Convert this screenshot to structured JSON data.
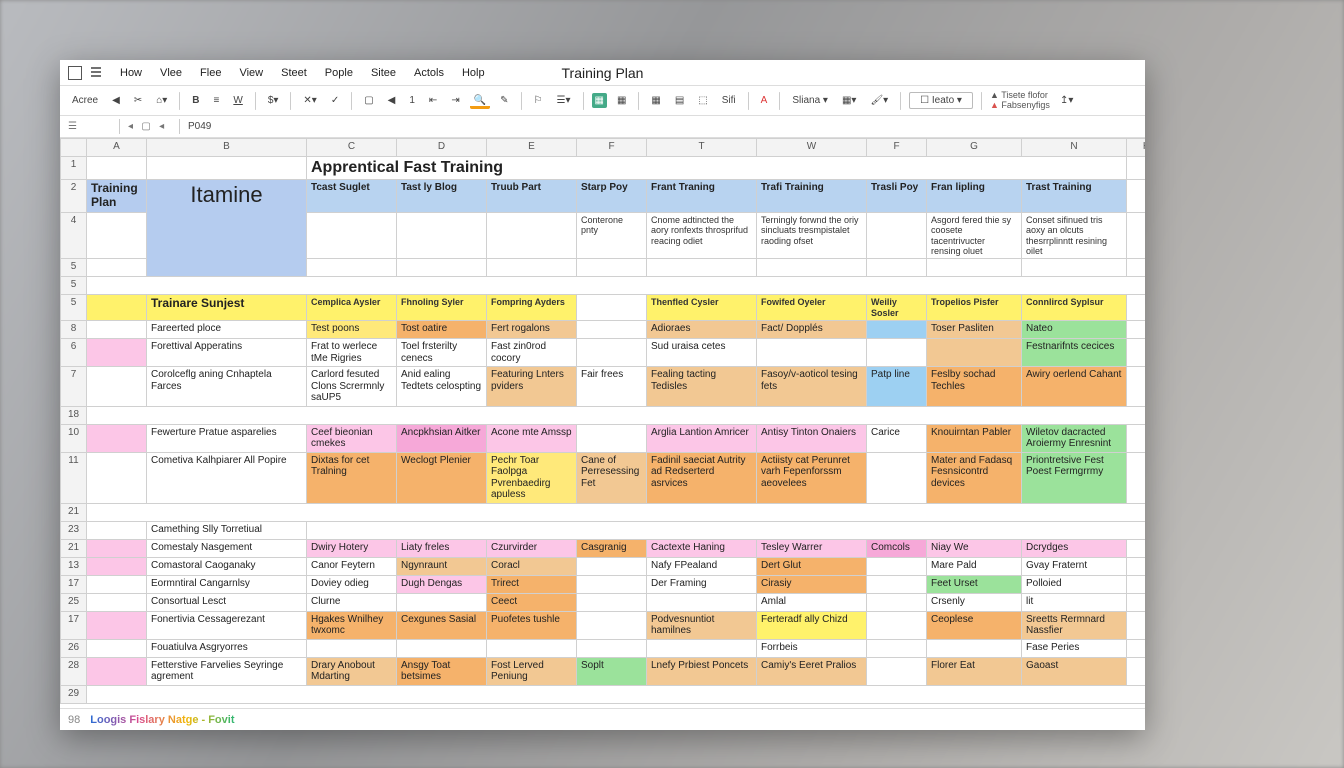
{
  "doc_title": "Training Plan",
  "menu": [
    "How",
    "Vlee",
    "Flee",
    "View",
    "Steet",
    "Pople",
    "Sitee",
    "Actols",
    "Holp"
  ],
  "toolbar_label_left": "Acree",
  "toolbar_num": "1",
  "toolbar_sig": "Sifi",
  "toolbar_sliana": "Sliana",
  "toolbar_dropdown": "Ieato",
  "toolbar_side_line1": "Tisete flofor",
  "toolbar_side_line2": "Fabsenyfigs",
  "formula_cell": "P049",
  "col_headers": [
    "A",
    "B",
    "C",
    "D",
    "E",
    "F",
    "T",
    "W",
    "F",
    "G",
    "N",
    "H"
  ],
  "rows": {
    "r1": {
      "title": "Apprentical Fast Training"
    },
    "r2": {
      "a": "Training Plan",
      "c": "Tcast Suglet",
      "d": "Tast ly Blog",
      "e": "Truub Part",
      "f": "Starp Poy",
      "t": "Frant Traning",
      "w": "Trafi Training",
      "pay": "Trasli Poy",
      "g": "Fran lipling",
      "n": "Trast Training"
    },
    "r4": {
      "f": "Conterone pnty",
      "t": "Cnome adtincted the aory ronfexts throsprifud reacing odiet",
      "w": "Terningly forwnd the oriy sincluats tresmpistalet raoding ofset",
      "g": "Asgord fered thie sy coosete tacentrivucter rensing oluet",
      "n": "Conset sifinued tris aoxy an olcuts thesrrplinntt resining oilet"
    },
    "r5_blank": true,
    "r5": {
      "b": "Trainare Sunjest",
      "c": "Cemplica Aysler",
      "d": "Fhnoling Syler",
      "e": "Fompring Ayders",
      "f": "",
      "t": "Thenfled Cysler",
      "w": "Fowifed Oyeler",
      "pay": "Weiliy Sosler",
      "g": "Tropelios Pisfer",
      "n": "Connlircd Syplsur"
    },
    "r8": {
      "b": "Fareerted  ploce",
      "c": "Test poons",
      "d": "Tost oatire",
      "e": "Fert rogalons",
      "t": "Adioraes",
      "w": "Fact/ Dopplés",
      "g": "Toser Pasliten",
      "n": "Nateo"
    },
    "r6": {
      "b": "Forettival Apperatins",
      "c": "Frat to werlece tMe Rigries",
      "d": "Toel frsterilty cenecs",
      "e": "Fast zin0rod cocory",
      "t": "Sud uraisa cetes",
      "n": "Festnarifnts cecices"
    },
    "r7": {
      "b": "Corolceflg aning Cnhaptela Farces",
      "c": "Carlord fesuted Clons Scrermnly saUP5",
      "d": "Anid ealing Tedtets celospting",
      "e": "Featuring Lnters pviders",
      "f": "Fair frees",
      "t": "Fealing tacting Tedisles",
      "w": "Fasoy/v-aoticol tesing fets",
      "pay": "Patp line",
      "g": "Feslby sochad Techles",
      "n": "Awiry oerlend Cahant"
    },
    "r10": {
      "b": "Fewerture Pratue asparelies",
      "c": "Ceef bieonian cmekes",
      "d": "Ancpkhsian Aitker",
      "e": "Acone mte Amssp",
      "t": "Arglia Lantion Amricer",
      "w": "Antisy Tinton Onaiers",
      "pay": "Carice",
      "g": "Knouirntan Pabler",
      "n": "Wiletov dacracted Aroiermy Enresnint"
    },
    "r11": {
      "b": "Cometiva Kalhpiarer All Popire",
      "c": "Dixtas for cet Tralning",
      "d": "Weclogt Plenier",
      "e": "Pechr Toar Faolpga Pvrenbaedirg apuless",
      "f": "Cane of Perresessing Fet",
      "t": "Fadinil saeciat Autrity ad Redserterd asrvices",
      "w": "Actiisty cat Perunret varh Fepenforssm aeovelees",
      "g": "Mater and Fadasq Fesnsicontrd devices",
      "n": "Priontretsive Fest Poest Fermgrrmy"
    },
    "r21_blank": true,
    "r23": {
      "b": "Camething Slly Torretiual"
    },
    "r21": {
      "b": "Comestaly Nasgement",
      "c": "Dwiry Hotery",
      "d": "Liaty freles",
      "e": "Czurvirder",
      "f": "Casgranig",
      "t": "Cactexte Haning",
      "w": "Tesley Warrer",
      "pay": "Comcols",
      "g": "Niay We",
      "n": "Dcrydges"
    },
    "r13": {
      "b": "Comastoral Caoganaky",
      "c": "Canor Feytern",
      "d": "Ngynraunt",
      "e": "Coracl",
      "t": "Nafy FPealand",
      "w": "Dert Glut",
      "g": "Mare Pald",
      "n": "Gvay Fraternt"
    },
    "r17a": {
      "b": "Eormntiral Cangarnlsy",
      "c": "Doviey odieg",
      "d": "Dugh Dengas",
      "e": "Trirect",
      "t": "Der Framing",
      "w": "Cirasiy",
      "g": "Feet Urset",
      "n": "Polloied"
    },
    "r25": {
      "b": "Consortual Lesct",
      "c": "Clurne",
      "e": "Ceect",
      "w": "Amlal",
      "g": "Crsenly",
      "n": "lit"
    },
    "r17b": {
      "b": "Fonertivia Cessagerezant",
      "c": "Hgakes Wnilhey twxomc",
      "d": "Cexgunes Sasial",
      "e": "Puofetes tushle",
      "t": "Podvesnuntiot hamilnes",
      "w": "Ferteradf ally Chizd",
      "g": "Ceoplese",
      "n": "Sreetts Rermnard Nassfier"
    },
    "r26": {
      "b": "Fouatiulva Asgryorres",
      "w": "Forrbeis",
      "n": "Fase Peries"
    },
    "r28": {
      "b": "Fetterstive Farvelies Seyringe agrement",
      "c": "Drary Anobout Mdarting",
      "d": "Ansgy Toat betsimes",
      "e": "Fost Lerved Peniung",
      "f": "Soplt",
      "t": "Lnefy Prbiest Poncets",
      "w": "Camiy's Eeret Pralios",
      "g": "Florer Eat",
      "n": "Gaoast"
    }
  },
  "footer_tab": "Loogis Fislary Natge - Fovit"
}
